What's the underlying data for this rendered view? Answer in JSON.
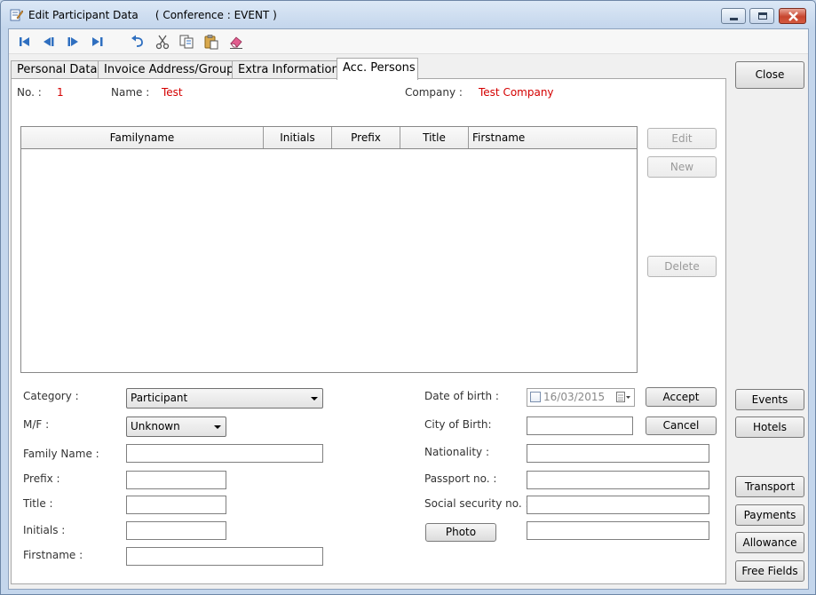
{
  "window": {
    "title": "Edit Participant Data",
    "subtitle": "( Conference : EVENT )"
  },
  "toolbar": {
    "icons": [
      "first-record-icon",
      "previous-record-icon",
      "next-record-icon",
      "last-record-icon",
      "undo-icon",
      "cut-icon",
      "copy-icon",
      "paste-icon",
      "erase-icon"
    ]
  },
  "tabs": [
    {
      "label": "Personal Data"
    },
    {
      "label": "Invoice Address/Group"
    },
    {
      "label": "Extra Information"
    },
    {
      "label": "Acc. Persons"
    }
  ],
  "header": {
    "no_label": "No. :",
    "no_value": "1",
    "name_label": "Name :",
    "name_value": "Test",
    "company_label": "Company :",
    "company_value": "Test Company"
  },
  "grid": {
    "columns": [
      "Familyname",
      "Initials",
      "Prefix",
      "Title",
      "Firstname"
    ]
  },
  "grid_buttons": {
    "edit": "Edit",
    "new": "New",
    "delete": "Delete"
  },
  "form": {
    "category_label": "Category  :",
    "category_value": "Participant",
    "mf_label": "M/F :",
    "mf_value": "Unknown",
    "family_name_label": "Family Name :",
    "prefix_label": "Prefix :",
    "title_label": "Title :",
    "initials_label": "Initials :",
    "firstname_label": "Firstname :",
    "dob_label": "Date of birth :",
    "dob_value": "16/03/2015",
    "city_label": "City of Birth:",
    "nationality_label": "Nationality :",
    "passport_label": "Passport no. :",
    "social_label": "Social security no. :",
    "photo_button": "Photo",
    "accept_button": "Accept",
    "cancel_button": "Cancel"
  },
  "side_buttons": {
    "close": "Close",
    "events": "Events",
    "hotels": "Hotels",
    "transport": "Transport",
    "payments": "Payments",
    "allowance": "Allowance",
    "free_fields": "Free Fields"
  },
  "colors": {
    "accent_blue": "#2f6fc0",
    "value_red": "#d40000"
  }
}
